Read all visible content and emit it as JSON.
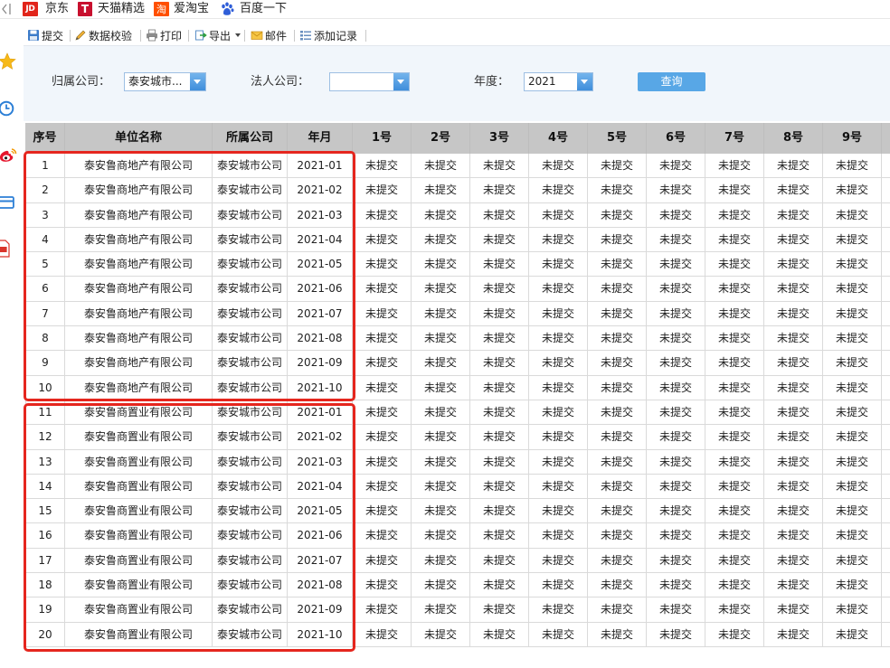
{
  "bookmarks": {
    "collapse_icon": "collapse-panel-icon",
    "items": [
      {
        "logo": "JD",
        "label": "京东"
      },
      {
        "logo": "T",
        "label": "天猫精选"
      },
      {
        "logo": "淘",
        "label": "爱淘宝"
      },
      {
        "icon": "baidu-paw-icon",
        "label": "百度一下"
      }
    ]
  },
  "sidebar": {
    "icons": [
      "star-icon",
      "clock-icon",
      "weibo-icon",
      "card-icon",
      "pdf-icon"
    ]
  },
  "toolbar": {
    "items": [
      {
        "icon": "save-icon",
        "label": "提交"
      },
      {
        "icon": "pencil-icon",
        "label": "数据校验"
      },
      {
        "icon": "printer-icon",
        "label": "打印"
      },
      {
        "icon": "export-icon",
        "label": "导出",
        "has_dropdown": true
      },
      {
        "icon": "mail-icon",
        "label": "邮件"
      },
      {
        "icon": "add-record-icon",
        "label": "添加记录"
      }
    ]
  },
  "filters": {
    "owner_company_label": "归属公司：",
    "owner_company_value": "泰安城市...",
    "legal_company_label": "法人公司：",
    "legal_company_value": "",
    "year_label": "年度：",
    "year_value": "2021",
    "query_button": "查询"
  },
  "table": {
    "columns": [
      "序号",
      "单位名称",
      "所属公司",
      "年月",
      "1号",
      "2号",
      "3号",
      "4号",
      "5号",
      "6号",
      "7号",
      "8号",
      "9号"
    ],
    "rows": [
      {
        "no": "1",
        "unit": "泰安鲁商地产有限公司",
        "company": "泰安城市公司",
        "month": "2021-01",
        "days": [
          "未提交",
          "未提交",
          "未提交",
          "未提交",
          "未提交",
          "未提交",
          "未提交",
          "未提交",
          "未提交"
        ]
      },
      {
        "no": "2",
        "unit": "泰安鲁商地产有限公司",
        "company": "泰安城市公司",
        "month": "2021-02",
        "days": [
          "未提交",
          "未提交",
          "未提交",
          "未提交",
          "未提交",
          "未提交",
          "未提交",
          "未提交",
          "未提交"
        ]
      },
      {
        "no": "3",
        "unit": "泰安鲁商地产有限公司",
        "company": "泰安城市公司",
        "month": "2021-03",
        "days": [
          "未提交",
          "未提交",
          "未提交",
          "未提交",
          "未提交",
          "未提交",
          "未提交",
          "未提交",
          "未提交"
        ]
      },
      {
        "no": "4",
        "unit": "泰安鲁商地产有限公司",
        "company": "泰安城市公司",
        "month": "2021-04",
        "days": [
          "未提交",
          "未提交",
          "未提交",
          "未提交",
          "未提交",
          "未提交",
          "未提交",
          "未提交",
          "未提交"
        ]
      },
      {
        "no": "5",
        "unit": "泰安鲁商地产有限公司",
        "company": "泰安城市公司",
        "month": "2021-05",
        "days": [
          "未提交",
          "未提交",
          "未提交",
          "未提交",
          "未提交",
          "未提交",
          "未提交",
          "未提交",
          "未提交"
        ]
      },
      {
        "no": "6",
        "unit": "泰安鲁商地产有限公司",
        "company": "泰安城市公司",
        "month": "2021-06",
        "days": [
          "未提交",
          "未提交",
          "未提交",
          "未提交",
          "未提交",
          "未提交",
          "未提交",
          "未提交",
          "未提交"
        ]
      },
      {
        "no": "7",
        "unit": "泰安鲁商地产有限公司",
        "company": "泰安城市公司",
        "month": "2021-07",
        "days": [
          "未提交",
          "未提交",
          "未提交",
          "未提交",
          "未提交",
          "未提交",
          "未提交",
          "未提交",
          "未提交"
        ]
      },
      {
        "no": "8",
        "unit": "泰安鲁商地产有限公司",
        "company": "泰安城市公司",
        "month": "2021-08",
        "days": [
          "未提交",
          "未提交",
          "未提交",
          "未提交",
          "未提交",
          "未提交",
          "未提交",
          "未提交",
          "未提交"
        ]
      },
      {
        "no": "9",
        "unit": "泰安鲁商地产有限公司",
        "company": "泰安城市公司",
        "month": "2021-09",
        "days": [
          "未提交",
          "未提交",
          "未提交",
          "未提交",
          "未提交",
          "未提交",
          "未提交",
          "未提交",
          "未提交"
        ]
      },
      {
        "no": "10",
        "unit": "泰安鲁商地产有限公司",
        "company": "泰安城市公司",
        "month": "2021-10",
        "days": [
          "未提交",
          "未提交",
          "未提交",
          "未提交",
          "未提交",
          "未提交",
          "未提交",
          "未提交",
          "未提交"
        ]
      },
      {
        "no": "11",
        "unit": "泰安鲁商置业有限公司",
        "company": "泰安城市公司",
        "month": "2021-01",
        "days": [
          "未提交",
          "未提交",
          "未提交",
          "未提交",
          "未提交",
          "未提交",
          "未提交",
          "未提交",
          "未提交"
        ]
      },
      {
        "no": "12",
        "unit": "泰安鲁商置业有限公司",
        "company": "泰安城市公司",
        "month": "2021-02",
        "days": [
          "未提交",
          "未提交",
          "未提交",
          "未提交",
          "未提交",
          "未提交",
          "未提交",
          "未提交",
          "未提交"
        ]
      },
      {
        "no": "13",
        "unit": "泰安鲁商置业有限公司",
        "company": "泰安城市公司",
        "month": "2021-03",
        "days": [
          "未提交",
          "未提交",
          "未提交",
          "未提交",
          "未提交",
          "未提交",
          "未提交",
          "未提交",
          "未提交"
        ]
      },
      {
        "no": "14",
        "unit": "泰安鲁商置业有限公司",
        "company": "泰安城市公司",
        "month": "2021-04",
        "days": [
          "未提交",
          "未提交",
          "未提交",
          "未提交",
          "未提交",
          "未提交",
          "未提交",
          "未提交",
          "未提交"
        ]
      },
      {
        "no": "15",
        "unit": "泰安鲁商置业有限公司",
        "company": "泰安城市公司",
        "month": "2021-05",
        "days": [
          "未提交",
          "未提交",
          "未提交",
          "未提交",
          "未提交",
          "未提交",
          "未提交",
          "未提交",
          "未提交"
        ]
      },
      {
        "no": "16",
        "unit": "泰安鲁商置业有限公司",
        "company": "泰安城市公司",
        "month": "2021-06",
        "days": [
          "未提交",
          "未提交",
          "未提交",
          "未提交",
          "未提交",
          "未提交",
          "未提交",
          "未提交",
          "未提交"
        ]
      },
      {
        "no": "17",
        "unit": "泰安鲁商置业有限公司",
        "company": "泰安城市公司",
        "month": "2021-07",
        "days": [
          "未提交",
          "未提交",
          "未提交",
          "未提交",
          "未提交",
          "未提交",
          "未提交",
          "未提交",
          "未提交"
        ]
      },
      {
        "no": "18",
        "unit": "泰安鲁商置业有限公司",
        "company": "泰安城市公司",
        "month": "2021-08",
        "days": [
          "未提交",
          "未提交",
          "未提交",
          "未提交",
          "未提交",
          "未提交",
          "未提交",
          "未提交",
          "未提交"
        ]
      },
      {
        "no": "19",
        "unit": "泰安鲁商置业有限公司",
        "company": "泰安城市公司",
        "month": "2021-09",
        "days": [
          "未提交",
          "未提交",
          "未提交",
          "未提交",
          "未提交",
          "未提交",
          "未提交",
          "未提交",
          "未提交"
        ]
      },
      {
        "no": "20",
        "unit": "泰安鲁商置业有限公司",
        "company": "泰安城市公司",
        "month": "2021-10",
        "days": [
          "未提交",
          "未提交",
          "未提交",
          "未提交",
          "未提交",
          "未提交",
          "未提交",
          "未提交",
          "未提交"
        ]
      }
    ]
  },
  "colors": {
    "highlight": "#e5261e",
    "header_bg": "#c6c6c6",
    "query_button": "#58a7e6",
    "filter_bg": "#f1f6fb",
    "grid_line": "#dadada"
  }
}
